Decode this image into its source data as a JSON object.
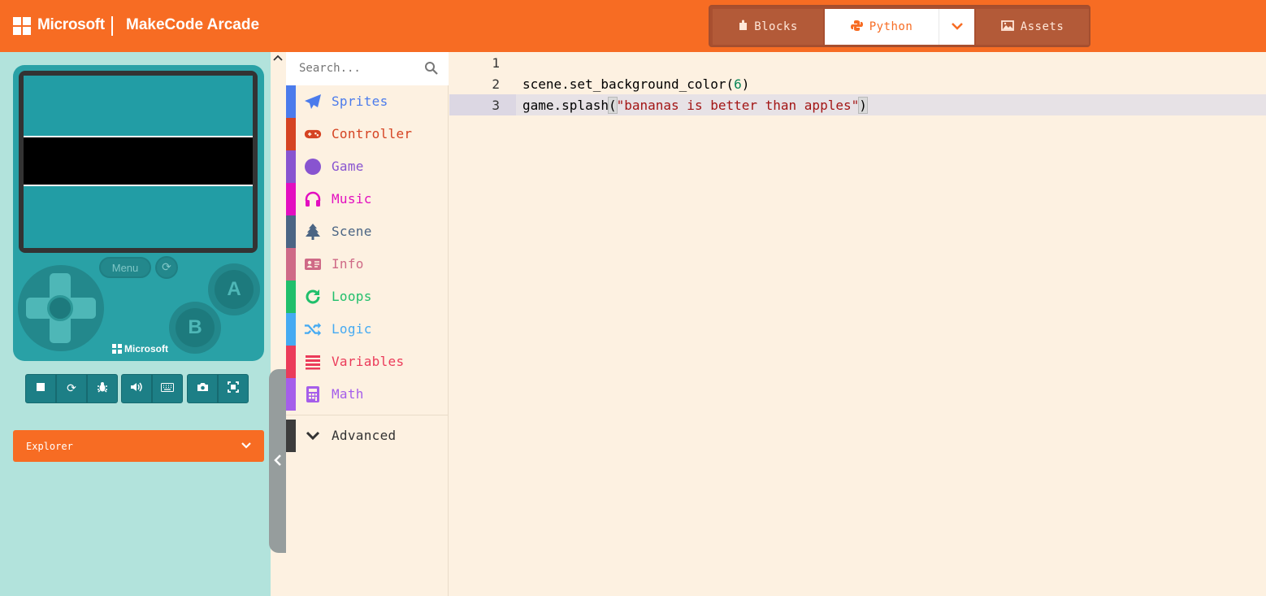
{
  "header": {
    "brand": "Microsoft",
    "app_title": "MakeCode Arcade",
    "tabs": {
      "blocks": "Blocks",
      "python": "Python",
      "assets": "Assets"
    }
  },
  "simulator": {
    "menu_label": "Menu",
    "a_label": "A",
    "b_label": "B",
    "brand": "Microsoft"
  },
  "explorer": {
    "label": "Explorer"
  },
  "toolbox": {
    "search_placeholder": "Search...",
    "categories": [
      {
        "label": "Sprites",
        "color": "#4b7bec"
      },
      {
        "label": "Controller",
        "color": "#d54322"
      },
      {
        "label": "Game",
        "color": "#8854d0"
      },
      {
        "label": "Music",
        "color": "#e30fc0"
      },
      {
        "label": "Scene",
        "color": "#4b6584"
      },
      {
        "label": "Info",
        "color": "#cf6a87"
      },
      {
        "label": "Loops",
        "color": "#20bf6b"
      },
      {
        "label": "Logic",
        "color": "#45aaf2"
      },
      {
        "label": "Variables",
        "color": "#eb3b5a"
      },
      {
        "label": "Math",
        "color": "#a55eea"
      }
    ],
    "advanced": "Advanced"
  },
  "editor": {
    "line_numbers": [
      "1",
      "2",
      "3"
    ],
    "line2": {
      "fn": "scene.set_background_color(",
      "arg": "6",
      "close": ")"
    },
    "line3": {
      "fn": "game.splash",
      "open": "(",
      "str": "\"bananas is better than apples\"",
      "close": ")"
    }
  },
  "colors": {
    "accent": "#f76c23",
    "sim_bg": "#b2e3dc",
    "console": "#29a1a6",
    "editor_bg": "#fdf1e1"
  }
}
